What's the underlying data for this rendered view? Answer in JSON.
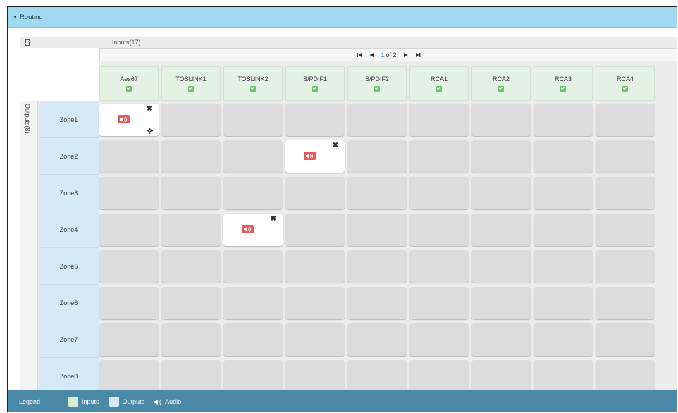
{
  "routing": {
    "title": "Routing"
  },
  "inputs_label": "Inputs(17)",
  "outputs_label": "Outputs(8)",
  "pager": {
    "current": "1",
    "of_label": "of 2"
  },
  "inputs": [
    "Aes67",
    "TOSLINK1",
    "TOSLINK2",
    "S/PDIF1",
    "S/PDIF2",
    "RCA1",
    "RCA2",
    "RCA3",
    "RCA4"
  ],
  "outputs": [
    "Zone1",
    "Zone2",
    "Zone3",
    "Zone4",
    "Zone5",
    "Zone6",
    "Zone7",
    "Zone8"
  ],
  "routes": [
    {
      "output": "Zone1",
      "input": "Aes67",
      "settings": true
    },
    {
      "output": "Zone2",
      "input": "S/PDIF1",
      "settings": false
    },
    {
      "output": "Zone4",
      "input": "TOSLINK2",
      "settings": false
    }
  ],
  "legend": {
    "title": "Legend",
    "inputs": "Inputs",
    "outputs": "Outputs",
    "audio": "Audio",
    "inputs_color": "#d5ecd5",
    "outputs_color": "#d6e9f6"
  },
  "colors": {
    "header": "#9fd9f2",
    "audio_badge": "#e85a5a",
    "legend_bar": "#4b89a8"
  },
  "icons": {
    "refresh": "refresh-icon",
    "first": "first-page-icon",
    "prev": "prev-page-icon",
    "next": "next-page-icon",
    "last": "last-page-icon",
    "audio": "speaker-icon",
    "remove": "close-icon",
    "settings": "gear-icon"
  }
}
